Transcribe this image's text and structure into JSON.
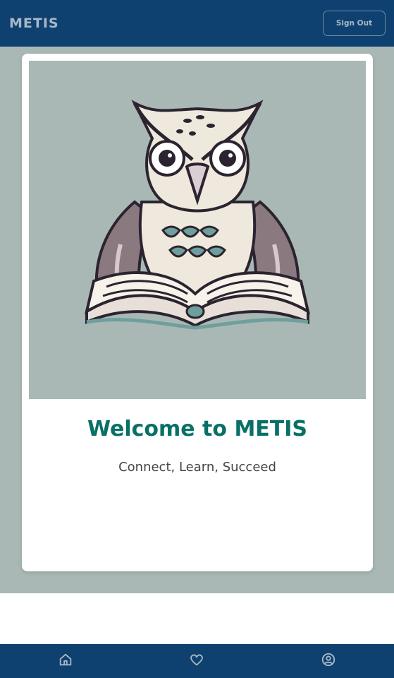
{
  "header": {
    "brand": "METIS",
    "signout_label": "Sign Out"
  },
  "hero": {
    "image_icon": "owl-reading-book-illustration",
    "title": "Welcome to METIS",
    "tagline": "Connect, Learn, Succeed"
  },
  "bottom_nav": {
    "items": [
      {
        "icon": "home-icon"
      },
      {
        "icon": "heart-icon"
      },
      {
        "icon": "user-circle-icon"
      }
    ]
  },
  "colors": {
    "header_bg": "#0e4170",
    "hero_bg": "#a9b8b4",
    "title_color": "#087066",
    "icon_color": "#a9b8c4"
  }
}
